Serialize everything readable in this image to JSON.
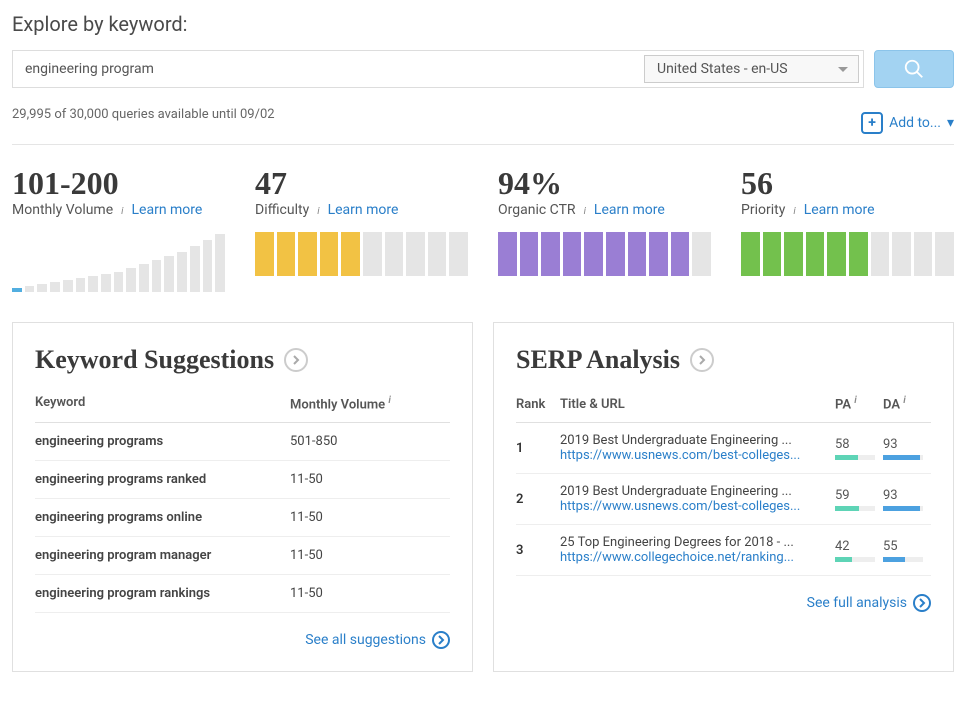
{
  "header": {
    "explore_label": "Explore by keyword:",
    "search_value": "engineering program",
    "locale_selected": "United States - en-US",
    "quota_text": "29,995 of 30,000 queries available until 09/02",
    "add_to_label": "Add to...",
    "add_to_caret": "▾"
  },
  "metrics": {
    "volume": {
      "value": "101-200",
      "label": "Monthly Volume",
      "learn": "Learn more",
      "bars": [
        4,
        6,
        8,
        10,
        12,
        14,
        16,
        18,
        20,
        24,
        28,
        32,
        36,
        40,
        46,
        52,
        58
      ],
      "active": [
        0
      ]
    },
    "difficulty": {
      "value": "47",
      "label": "Difficulty",
      "learn": "Learn more",
      "filled": 5,
      "total": 10,
      "color": "yellow"
    },
    "ctr": {
      "value": "94%",
      "label": "Organic CTR",
      "learn": "Learn more",
      "filled": 9,
      "total": 10,
      "color": "purple"
    },
    "priority": {
      "value": "56",
      "label": "Priority",
      "learn": "Learn more",
      "filled": 6,
      "total": 10,
      "color": "green"
    }
  },
  "suggestions": {
    "title": "Keyword Suggestions",
    "col_keyword": "Keyword",
    "col_volume": "Monthly Volume",
    "rows": [
      {
        "keyword": "engineering programs",
        "volume": "501-850"
      },
      {
        "keyword": "engineering programs ranked",
        "volume": "11-50"
      },
      {
        "keyword": "engineering programs online",
        "volume": "11-50"
      },
      {
        "keyword": "engineering program manager",
        "volume": "11-50"
      },
      {
        "keyword": "engineering program rankings",
        "volume": "11-50"
      }
    ],
    "see_all": "See all suggestions"
  },
  "serp": {
    "title": "SERP Analysis",
    "col_rank": "Rank",
    "col_title": "Title & URL",
    "col_pa": "PA",
    "col_da": "DA",
    "rows": [
      {
        "rank": "1",
        "title": "2019 Best Undergraduate Engineering ...",
        "url": "https://www.usnews.com/best-colleges...",
        "pa": 58,
        "da": 93
      },
      {
        "rank": "2",
        "title": "2019 Best Undergraduate Engineering ...",
        "url": "https://www.usnews.com/best-colleges...",
        "pa": 59,
        "da": 93
      },
      {
        "rank": "3",
        "title": "25 Top Engineering Degrees for 2018 - ...",
        "url": "https://www.collegechoice.net/ranking...",
        "pa": 42,
        "da": 55
      }
    ],
    "see_full": "See full analysis"
  }
}
